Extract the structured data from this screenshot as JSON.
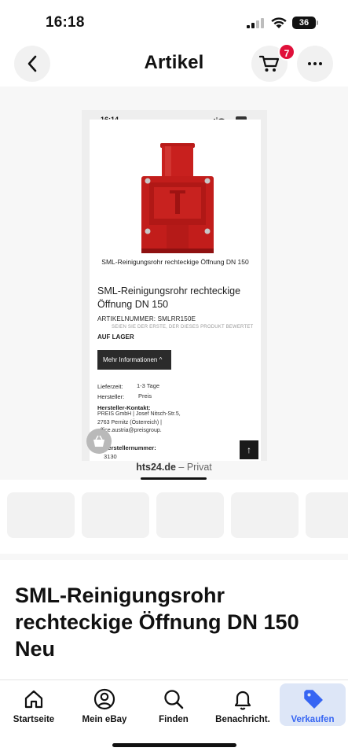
{
  "status_bar": {
    "time": "16:18",
    "battery": "36"
  },
  "header": {
    "title": "Artikel",
    "cart_count": "7"
  },
  "screenshot": {
    "time": "16:14",
    "caption": "SML-Reinigungsrohr rechteckige Öffnung DN 150",
    "title": "SML-Reinigungsrohr rechteckige Öffnung DN 150",
    "article_number": "ARTIKELNUMMER:  SMLRR150E",
    "rating_text": "SEIEN SIE DER ERSTE, DER DIESES PRODUKT BEWERTET",
    "stock": "AUF LAGER",
    "more_info": "Mehr Informationen",
    "delivery_label": "Lieferzeit:",
    "delivery_value": "1-3 Tage",
    "manufacturer_label": "Hersteller:",
    "manufacturer_value": "Preis",
    "contact_label": "Hersteller-Kontakt:",
    "contact_value": "PREIS GmbH | Josef Nitsch-Str.5, 2763 Pernitz (Österreich) | office.austria@preisgroup.",
    "mfr_number_label": "Herstellernummer:",
    "mfr_number_value": "3130",
    "up_arrow": "↑"
  },
  "source": {
    "domain": "hts24.de",
    "suffix": " – Privat"
  },
  "listing": {
    "title": "SML-Reinigungsrohr rechteckige Öffnung DN 150 Neu"
  },
  "tabs": [
    {
      "label": "Startseite",
      "icon": "home-icon"
    },
    {
      "label": "Mein eBay",
      "icon": "user-icon"
    },
    {
      "label": "Finden",
      "icon": "search-icon"
    },
    {
      "label": "Benachricht.",
      "icon": "bell-icon"
    },
    {
      "label": "Verkaufen",
      "icon": "tag-icon"
    }
  ],
  "colors": {
    "accent": "#3665f3",
    "badge": "#e0103a",
    "product": "#c8201e"
  }
}
